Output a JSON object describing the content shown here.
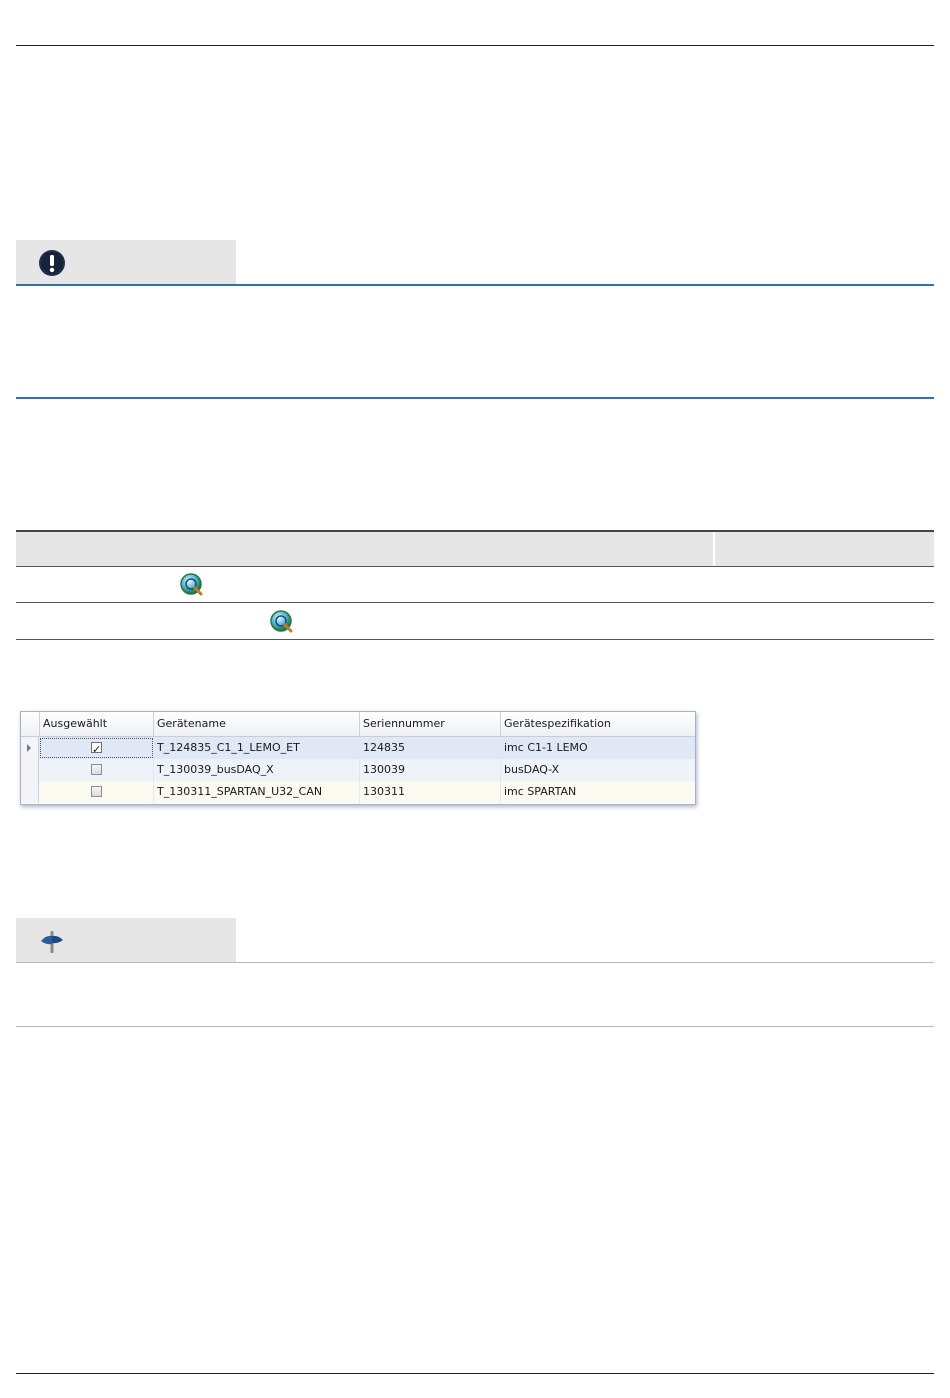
{
  "device_grid": {
    "columns": [
      "Ausgewählt",
      "Gerätename",
      "Seriennummer",
      "Gerätespezifikation"
    ],
    "rows": [
      {
        "selected": true,
        "name": "T_124835_C1_1_LEMO_ET",
        "serial": "124835",
        "spec": "imc C1-1 LEMO"
      },
      {
        "selected": false,
        "name": "T_130039_busDAQ_X",
        "serial": "130039",
        "spec": "busDAQ-X"
      },
      {
        "selected": false,
        "name": "T_130311_SPARTAN_U32_CAN",
        "serial": "130311",
        "spec": "imc SPARTAN"
      }
    ]
  },
  "colors": {
    "accent_blue": "#2f6fb3",
    "callout_bg": "#e6e6e6",
    "selected_row": "#dfe8f4",
    "alt_row": "#eef3fa",
    "cream_row": "#fbfaf0"
  },
  "icons": [
    "important-icon",
    "magnifier-icon",
    "signpost-icon",
    "checkbox-icon"
  ]
}
